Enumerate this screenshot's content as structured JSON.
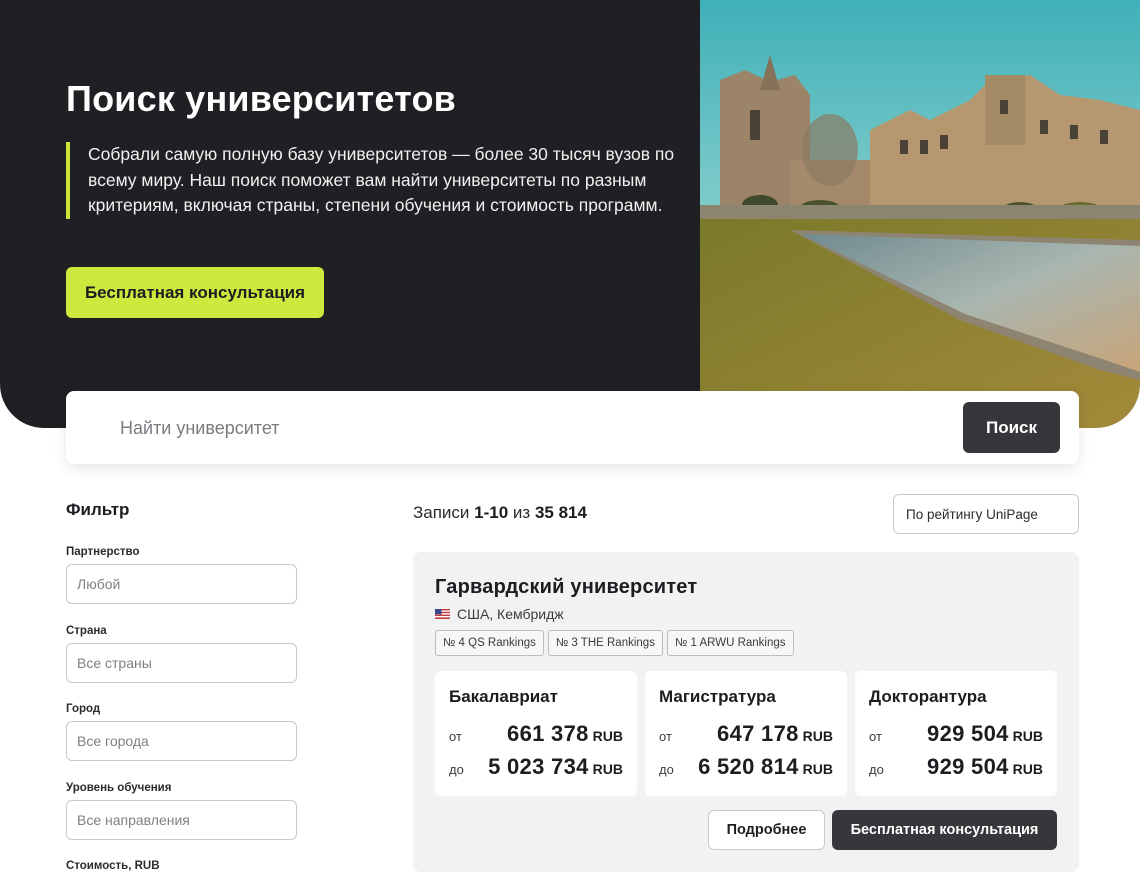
{
  "hero": {
    "title": "Поиск университетов",
    "description": "Собрали самую полную базу университетов — более 30 тысяч вузов по всему миру. Наш поиск поможет вам найти университеты по разным критериям, включая страны, степени обучения и стоимость программ.",
    "cta_label": "Бесплатная консультация",
    "accent_color": "#cfe83e"
  },
  "search": {
    "placeholder": "Найти университет",
    "button_label": "Поиск"
  },
  "filter": {
    "title": "Фильтр",
    "groups": [
      {
        "label": "Партнерство",
        "placeholder": "Любой"
      },
      {
        "label": "Страна",
        "placeholder": "Все страны"
      },
      {
        "label": "Город",
        "placeholder": "Все города"
      },
      {
        "label": "Уровень обучения",
        "placeholder": "Все направления"
      },
      {
        "label": "Стоимость, RUB"
      }
    ]
  },
  "results": {
    "records_prefix": "Записи",
    "records_range": "1-10",
    "records_of": "из",
    "records_total": "35 814",
    "sort_label": "По рейтингу UniPage"
  },
  "university": {
    "name": "Гарвардский университет",
    "location": "США, Кембридж",
    "flag": "us-flag-icon",
    "rankings": [
      "№ 4 QS Rankings",
      "№ 3 THE Rankings",
      "№ 1 ARWU Rankings"
    ],
    "degrees": [
      {
        "title": "Бакалавриат",
        "from_prefix": "от",
        "from": "661 378",
        "to_prefix": "до",
        "to": "5 023 734",
        "currency": "RUB"
      },
      {
        "title": "Магистратура",
        "from_prefix": "от",
        "from": "647 178",
        "to_prefix": "до",
        "to": "6 520 814",
        "currency": "RUB"
      },
      {
        "title": "Докторантура",
        "from_prefix": "от",
        "from": "929 504",
        "to_prefix": "до",
        "to": "929 504",
        "currency": "RUB"
      }
    ],
    "more_label": "Подробнее",
    "consult_label": "Бесплатная консультация"
  }
}
